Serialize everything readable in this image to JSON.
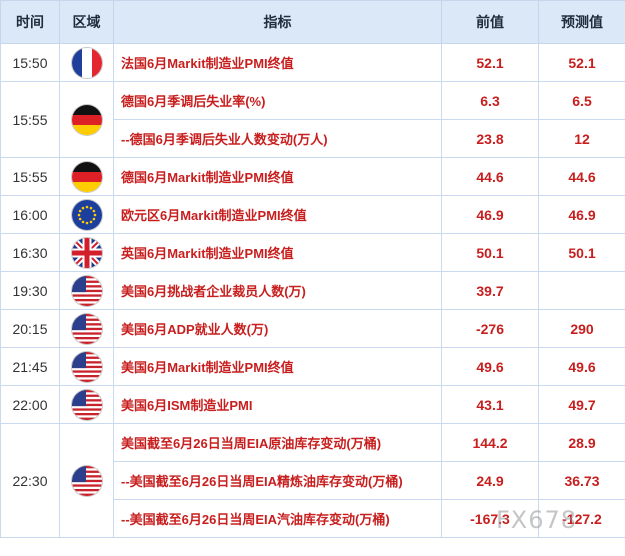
{
  "headers": {
    "time": "时间",
    "region": "区域",
    "indicator": "指标",
    "previous": "前值",
    "forecast": "预测值"
  },
  "rows": [
    {
      "time": "15:50",
      "flag": "france-flag-icon",
      "indicator": "法国6月Markit制造业PMI终值",
      "previous": "52.1",
      "forecast": "52.1"
    },
    {
      "time": "15:55",
      "flag": "germany-flag-icon",
      "indicator": "德国6月季调后失业率(%)",
      "previous": "6.3",
      "forecast": "6.5"
    },
    {
      "time": "",
      "flag": "",
      "indicator": "--德国6月季调后失业人数变动(万人)",
      "previous": "23.8",
      "forecast": "12"
    },
    {
      "time": "15:55",
      "flag": "germany-flag-icon",
      "indicator": "德国6月Markit制造业PMI终值",
      "previous": "44.6",
      "forecast": "44.6"
    },
    {
      "time": "16:00",
      "flag": "eu-flag-icon",
      "indicator": "欧元区6月Markit制造业PMI终值",
      "previous": "46.9",
      "forecast": "46.9"
    },
    {
      "time": "16:30",
      "flag": "uk-flag-icon",
      "indicator": "英国6月Markit制造业PMI终值",
      "previous": "50.1",
      "forecast": "50.1"
    },
    {
      "time": "19:30",
      "flag": "us-flag-icon",
      "indicator": "美国6月挑战者企业裁员人数(万)",
      "previous": "39.7",
      "forecast": ""
    },
    {
      "time": "20:15",
      "flag": "us-flag-icon",
      "indicator": "美国6月ADP就业人数(万)",
      "previous": "-276",
      "forecast": "290"
    },
    {
      "time": "21:45",
      "flag": "us-flag-icon",
      "indicator": "美国6月Markit制造业PMI终值",
      "previous": "49.6",
      "forecast": "49.6"
    },
    {
      "time": "22:00",
      "flag": "us-flag-icon",
      "indicator": "美国6月ISM制造业PMI",
      "previous": "43.1",
      "forecast": "49.7"
    },
    {
      "time": "22:30",
      "flag": "us-flag-icon",
      "indicator": "美国截至6月26日当周EIA原油库存变动(万桶)",
      "previous": "144.2",
      "forecast": "28.9"
    },
    {
      "time": "",
      "flag": "",
      "indicator": "--美国截至6月26日当周EIA精炼油库存变动(万桶)",
      "previous": "24.9",
      "forecast": "36.73"
    },
    {
      "time": "",
      "flag": "",
      "indicator": "--美国截至6月26日当周EIA汽油库存变动(万桶)",
      "previous": "-167.3",
      "forecast": "-127.2"
    }
  ],
  "watermark": "FX678",
  "colors": {
    "header_bg": "#dbe8f8",
    "value_red": "#c81e1e",
    "border": "#c9daf0"
  }
}
